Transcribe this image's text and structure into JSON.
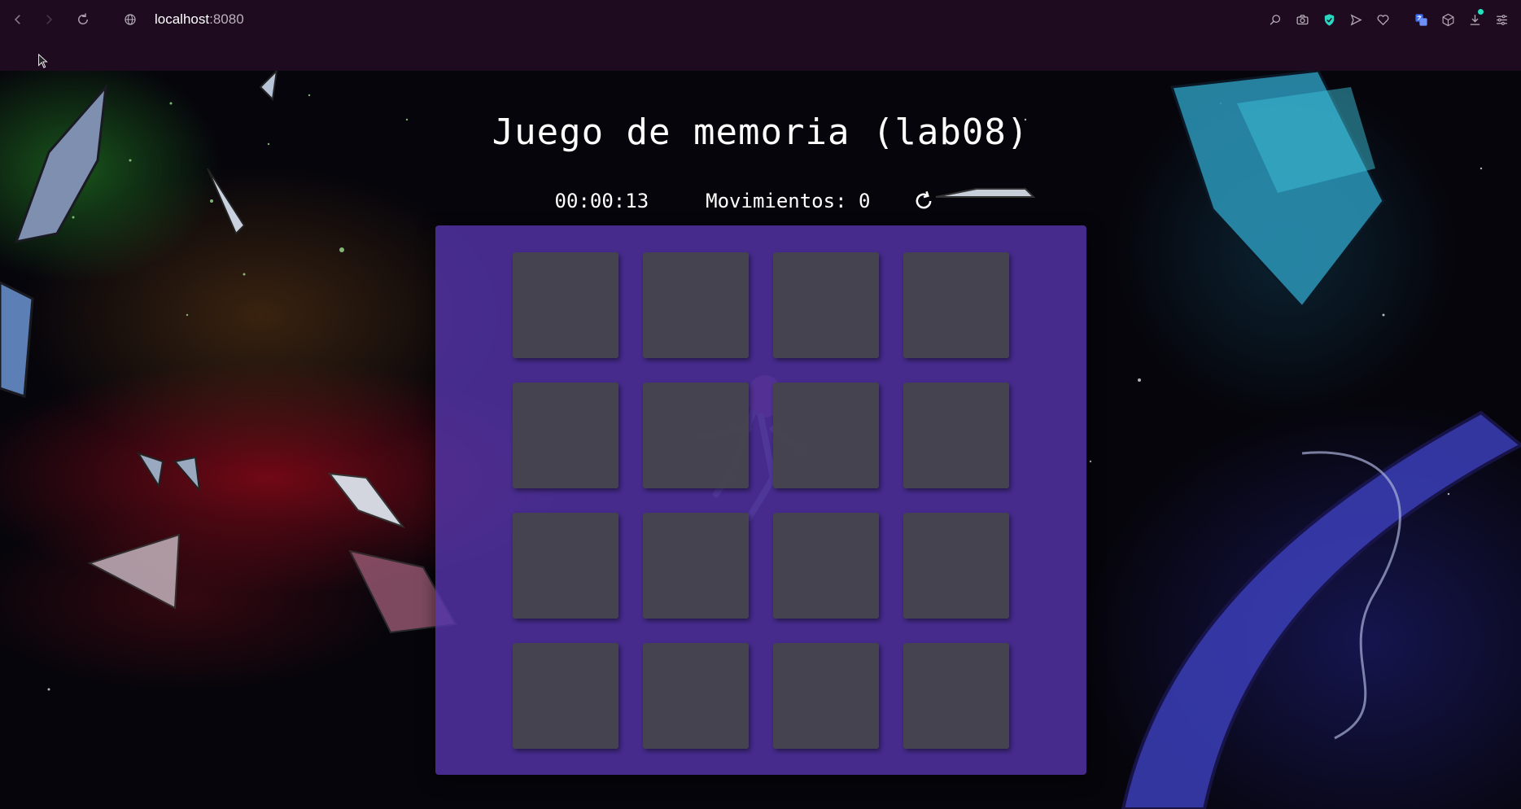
{
  "browser": {
    "url_host": "localhost",
    "url_port": ":8080",
    "icons": [
      "back-icon",
      "forward-icon",
      "reload-icon",
      "site-info-icon",
      "zoom-icon",
      "camera-icon",
      "shield-icon",
      "send-icon",
      "heart-icon",
      "translate-icon",
      "box-icon",
      "download-icon",
      "settings-icon"
    ]
  },
  "game": {
    "title": "Juego de memoria (lab08)",
    "timer": "00:00:13",
    "moves_label": "Movimientos: ",
    "moves_value": "0",
    "card_count": 16,
    "board_color": "#5434aa",
    "card_color": "#444648"
  }
}
